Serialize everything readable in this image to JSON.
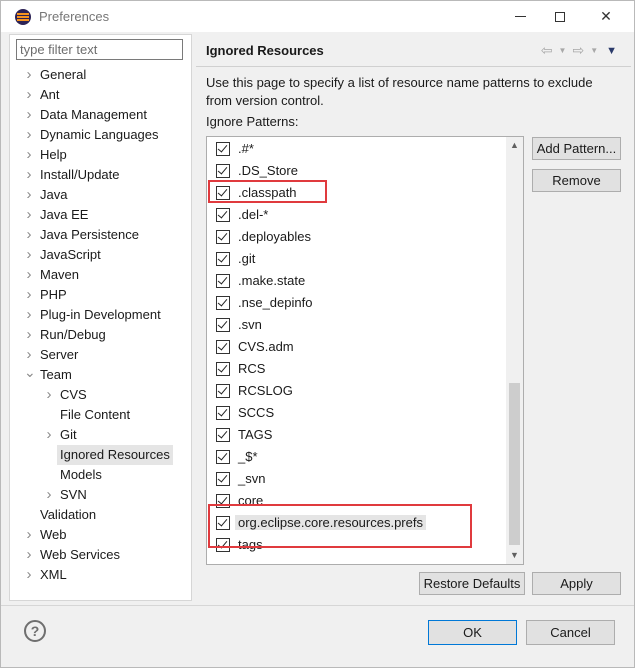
{
  "window": {
    "title": "Preferences"
  },
  "sidebar": {
    "filter_placeholder": "type filter text",
    "items": [
      {
        "label": "General",
        "chevron": true,
        "level": 0
      },
      {
        "label": "Ant",
        "chevron": true,
        "level": 0
      },
      {
        "label": "Data Management",
        "chevron": true,
        "level": 0
      },
      {
        "label": "Dynamic Languages",
        "chevron": true,
        "level": 0
      },
      {
        "label": "Help",
        "chevron": true,
        "level": 0
      },
      {
        "label": "Install/Update",
        "chevron": true,
        "level": 0
      },
      {
        "label": "Java",
        "chevron": true,
        "level": 0
      },
      {
        "label": "Java EE",
        "chevron": true,
        "level": 0
      },
      {
        "label": "Java Persistence",
        "chevron": true,
        "level": 0
      },
      {
        "label": "JavaScript",
        "chevron": true,
        "level": 0
      },
      {
        "label": "Maven",
        "chevron": true,
        "level": 0
      },
      {
        "label": "PHP",
        "chevron": true,
        "level": 0
      },
      {
        "label": "Plug-in Development",
        "chevron": true,
        "level": 0
      },
      {
        "label": "Run/Debug",
        "chevron": true,
        "level": 0
      },
      {
        "label": "Server",
        "chevron": true,
        "level": 0
      },
      {
        "label": "Team",
        "chevron": true,
        "expanded": true,
        "level": 0
      },
      {
        "label": "CVS",
        "chevron": true,
        "level": 1
      },
      {
        "label": "File Content",
        "chevron": false,
        "level": 1
      },
      {
        "label": "Git",
        "chevron": true,
        "level": 1
      },
      {
        "label": "Ignored Resources",
        "chevron": false,
        "level": 1,
        "selected": true
      },
      {
        "label": "Models",
        "chevron": false,
        "level": 1
      },
      {
        "label": "SVN",
        "chevron": true,
        "level": 1
      },
      {
        "label": "Validation",
        "chevron": false,
        "level": 0
      },
      {
        "label": "Web",
        "chevron": true,
        "level": 0
      },
      {
        "label": "Web Services",
        "chevron": true,
        "level": 0
      },
      {
        "label": "XML",
        "chevron": true,
        "level": 0
      }
    ]
  },
  "page": {
    "title": "Ignored Resources",
    "description": "Use this page to specify a list of resource name patterns to exclude from version control.",
    "patterns_label": "Ignore Patterns:",
    "patterns": [
      {
        "text": ".#*",
        "checked": true
      },
      {
        "text": ".DS_Store",
        "checked": true
      },
      {
        "text": ".classpath",
        "checked": true
      },
      {
        "text": ".del-*",
        "checked": true
      },
      {
        "text": ".deployables",
        "checked": true
      },
      {
        "text": ".git",
        "checked": true
      },
      {
        "text": ".make.state",
        "checked": true
      },
      {
        "text": ".nse_depinfo",
        "checked": true
      },
      {
        "text": ".svn",
        "checked": true
      },
      {
        "text": "CVS.adm",
        "checked": true
      },
      {
        "text": "RCS",
        "checked": true
      },
      {
        "text": "RCSLOG",
        "checked": true
      },
      {
        "text": "SCCS",
        "checked": true
      },
      {
        "text": "TAGS",
        "checked": true
      },
      {
        "text": "_$*",
        "checked": true
      },
      {
        "text": "_svn",
        "checked": true
      },
      {
        "text": "core",
        "checked": true
      },
      {
        "text": "org.eclipse.core.resources.prefs",
        "checked": true,
        "selected": true
      },
      {
        "text": "tags",
        "checked": true
      }
    ],
    "add_pattern_label": "Add Pattern...",
    "remove_label": "Remove",
    "restore_defaults_label": "Restore Defaults",
    "apply_label": "Apply"
  },
  "footer": {
    "ok_label": "OK",
    "cancel_label": "Cancel"
  },
  "colors": {
    "highlight_box": "#e03a3e",
    "selection": "#e5e5e5",
    "ok_border": "#0078d7"
  }
}
